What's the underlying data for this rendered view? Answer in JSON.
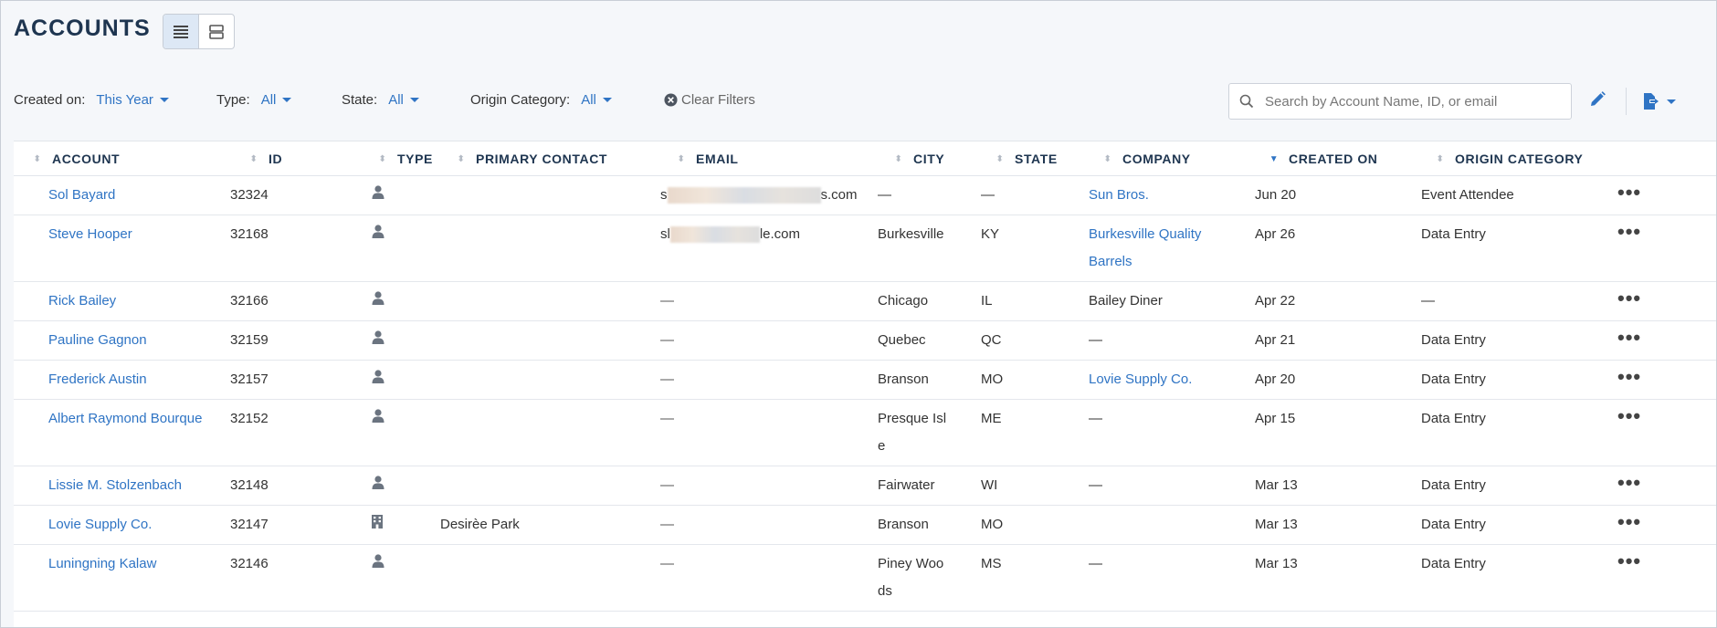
{
  "header": {
    "title": "ACCOUNTS",
    "view_toggle": {
      "list_icon": "list-view-icon",
      "card_icon": "card-view-icon"
    }
  },
  "filters": {
    "created_on": {
      "label": "Created on:",
      "value": "This Year"
    },
    "type": {
      "label": "Type:",
      "value": "All"
    },
    "state": {
      "label": "State:",
      "value": "All"
    },
    "origin_category": {
      "label": "Origin Category:",
      "value": "All"
    },
    "clear_label": "Clear Filters"
  },
  "search": {
    "placeholder": "Search by Account Name, ID, or email",
    "value": ""
  },
  "toolbar": {
    "edit_icon": "pencil-icon",
    "export_icon": "export-file-icon"
  },
  "colors": {
    "accent": "#2f74c4",
    "title": "#1e3550",
    "background": "#f5f7fa"
  },
  "table": {
    "columns": [
      {
        "key": "account",
        "label": "ACCOUNT"
      },
      {
        "key": "id",
        "label": "ID"
      },
      {
        "key": "type",
        "label": "TYPE"
      },
      {
        "key": "primary_contact",
        "label": "PRIMARY CONTACT"
      },
      {
        "key": "email",
        "label": "EMAIL"
      },
      {
        "key": "city",
        "label": "CITY"
      },
      {
        "key": "state",
        "label": "STATE"
      },
      {
        "key": "company",
        "label": "COMPANY"
      },
      {
        "key": "created_on",
        "label": "CREATED ON",
        "sorted": true
      },
      {
        "key": "origin_category",
        "label": "ORIGIN CATEGORY"
      }
    ],
    "rows": [
      {
        "account": "Sol Bayard",
        "id": "32324",
        "type": "person",
        "primary_contact": "",
        "email_prefix": "s",
        "email_suffix": "s.com",
        "city": "—",
        "state": "—",
        "company": "Sun Bros.",
        "company_link": true,
        "created_on": "Jun 20",
        "origin_category": "Event Attendee"
      },
      {
        "account": "Steve Hooper",
        "id": "32168",
        "type": "person",
        "primary_contact": "",
        "email_prefix": "sl",
        "email_suffix": "le.com",
        "city": "Burkesville",
        "state": "KY",
        "company": "Burkesville Quality Barrels",
        "company_link": true,
        "created_on": "Apr 26",
        "origin_category": "Data Entry"
      },
      {
        "account": "Rick Bailey",
        "id": "32166",
        "type": "person",
        "primary_contact": "",
        "email": "—",
        "city": "Chicago",
        "state": "IL",
        "company": "Bailey Diner",
        "company_link": false,
        "created_on": "Apr 22",
        "origin_category": "—"
      },
      {
        "account": "Pauline Gagnon",
        "id": "32159",
        "type": "person",
        "primary_contact": "",
        "email": "—",
        "city": "Quebec",
        "state": "QC",
        "company": "—",
        "company_link": false,
        "created_on": "Apr 21",
        "origin_category": "Data Entry"
      },
      {
        "account": "Frederick Austin",
        "id": "32157",
        "type": "person",
        "primary_contact": "",
        "email": "—",
        "city": "Branson",
        "state": "MO",
        "company": "Lovie Supply Co.",
        "company_link": true,
        "created_on": "Apr 20",
        "origin_category": "Data Entry"
      },
      {
        "account": "Albert Raymond Bourque",
        "id": "32152",
        "type": "person",
        "primary_contact": "",
        "email": "—",
        "city": "Presque Isle",
        "state": "ME",
        "company": "—",
        "company_link": false,
        "created_on": "Apr 15",
        "origin_category": "Data Entry"
      },
      {
        "account": "Lissie M. Stolzenbach",
        "id": "32148",
        "type": "person",
        "primary_contact": "",
        "email": "—",
        "city": "Fairwater",
        "state": "WI",
        "company": "—",
        "company_link": false,
        "created_on": "Mar 13",
        "origin_category": "Data Entry"
      },
      {
        "account": "Lovie Supply Co.",
        "id": "32147",
        "type": "company",
        "primary_contact": "Desirèe Park",
        "email": "—",
        "city": "Branson",
        "state": "MO",
        "company": "",
        "company_link": false,
        "created_on": "Mar 13",
        "origin_category": "Data Entry"
      },
      {
        "account": "Luningning Kalaw",
        "id": "32146",
        "type": "person",
        "primary_contact": "",
        "email": "—",
        "city": "Piney Woods",
        "state": "MS",
        "company": "—",
        "company_link": false,
        "created_on": "Mar 13",
        "origin_category": "Data Entry"
      }
    ],
    "row_action_icon": "more-options-icon"
  }
}
